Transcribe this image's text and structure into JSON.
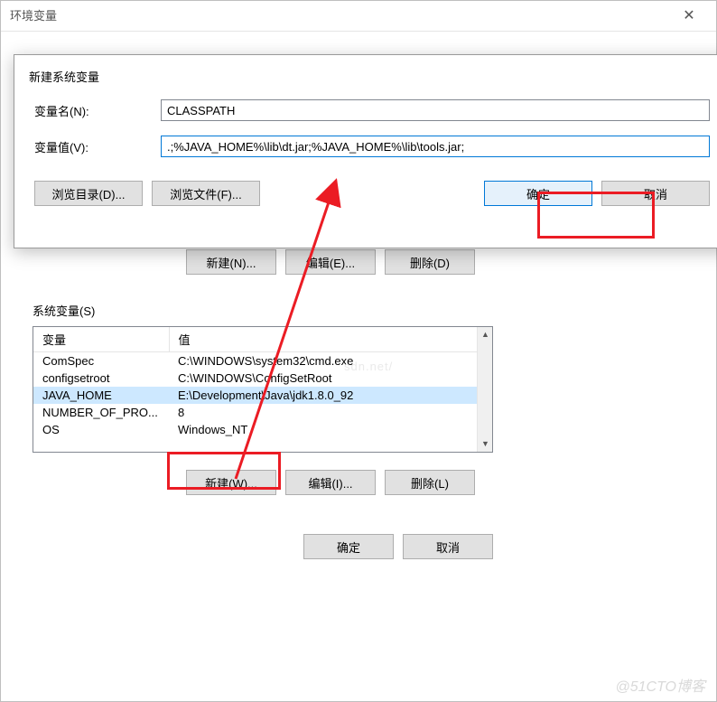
{
  "outer": {
    "title": "环境变量",
    "close_glyph": "✕",
    "mid_buttons": {
      "new": "新建(N)...",
      "edit": "编辑(E)...",
      "delete": "删除(D)"
    },
    "sysvars_label": "系统变量(S)",
    "table": {
      "headers": {
        "var": "变量",
        "val": "值"
      },
      "rows": [
        {
          "var": "ComSpec",
          "val": "C:\\WINDOWS\\system32\\cmd.exe"
        },
        {
          "var": "configsetroot",
          "val": "C:\\WINDOWS\\ConfigSetRoot"
        },
        {
          "var": "JAVA_HOME",
          "val": "E:\\Development\\Java\\jdk1.8.0_92",
          "selected": true
        },
        {
          "var": "NUMBER_OF_PRO...",
          "val": "8"
        },
        {
          "var": "OS",
          "val": "Windows_NT"
        }
      ]
    },
    "sysvars_buttons": {
      "new": "新建(W)...",
      "edit": "编辑(I)...",
      "delete": "删除(L)"
    },
    "footer_buttons": {
      "ok": "确定",
      "cancel": "取消"
    }
  },
  "modal": {
    "title": "新建系统变量",
    "name_label": "变量名(N):",
    "name_value": "CLASSPATH",
    "value_label": "变量值(V):",
    "value_value": ".;%JAVA_HOME%\\lib\\dt.jar;%JAVA_HOME%\\lib\\tools.jar;",
    "browse_dir": "浏览目录(D)...",
    "browse_file": "浏览文件(F)...",
    "ok": "确定",
    "cancel": "取消"
  },
  "watermark": "@51CTO博客",
  "watermark_mid": "sdn.net/"
}
